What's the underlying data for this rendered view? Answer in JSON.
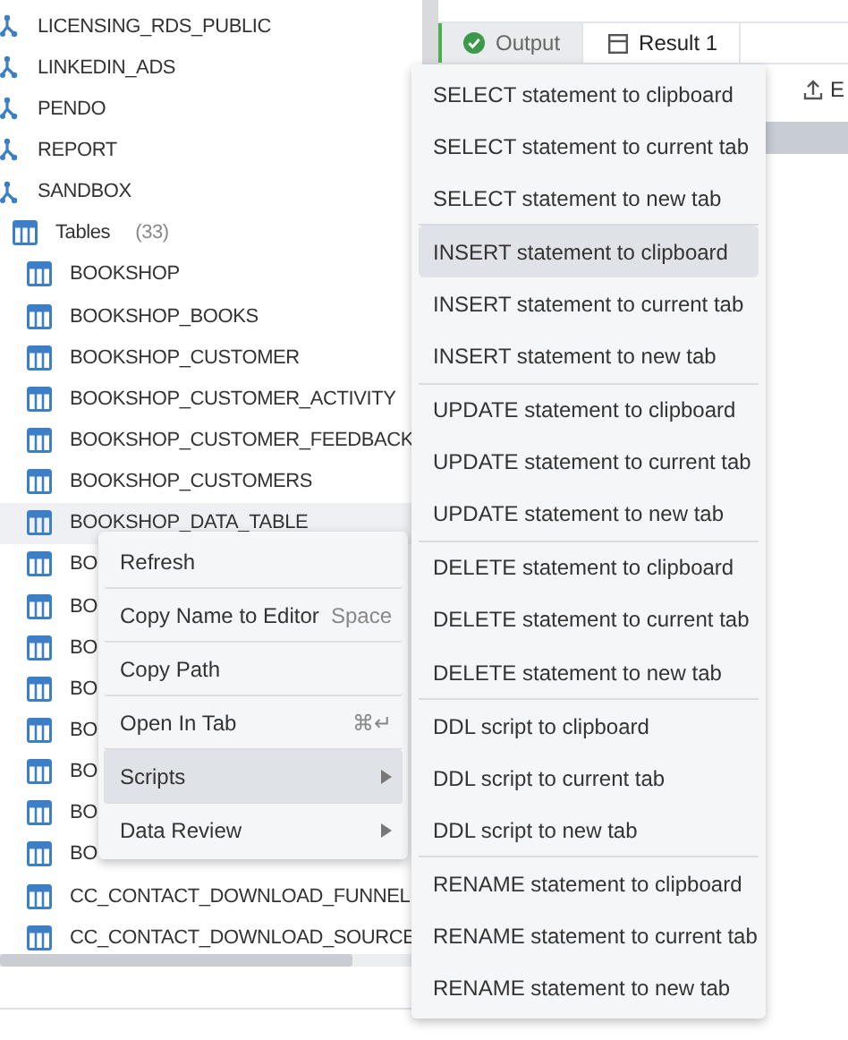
{
  "tree": {
    "schemas": [
      {
        "name": "LICENSING_RDS_PUBLIC"
      },
      {
        "name": "LINKEDIN_ADS"
      },
      {
        "name": "PENDO"
      },
      {
        "name": "REPORT"
      },
      {
        "name": "SANDBOX"
      }
    ],
    "tables_group": {
      "label": "Tables",
      "count": "(33)"
    },
    "tables": [
      {
        "name": "BOOKSHOP",
        "selected": false
      },
      {
        "name": "BOOKSHOP_BOOKS",
        "selected": false
      },
      {
        "name": "BOOKSHOP_CUSTOMER",
        "selected": false
      },
      {
        "name": "BOOKSHOP_CUSTOMER_ACTIVITY",
        "selected": false
      },
      {
        "name": "BOOKSHOP_CUSTOMER_FEEDBACK",
        "selected": false
      },
      {
        "name": "BOOKSHOP_CUSTOMERS",
        "selected": false
      },
      {
        "name": "BOOKSHOP_DATA_TABLE",
        "selected": true
      },
      {
        "name": "BO",
        "selected": false
      },
      {
        "name": "BO",
        "selected": false
      },
      {
        "name": "BO",
        "selected": false
      },
      {
        "name": "BO",
        "selected": false
      },
      {
        "name": "BO",
        "selected": false
      },
      {
        "name": "BO",
        "selected": false
      },
      {
        "name": "BO",
        "selected": false
      },
      {
        "name": "BO",
        "selected": false
      },
      {
        "name": "CC_CONTACT_DOWNLOAD_FUNNEL",
        "selected": false
      },
      {
        "name": "CC_CONTACT_DOWNLOAD_SOURCE",
        "selected": false
      }
    ]
  },
  "tabs": [
    {
      "label": "Output",
      "kind": "output",
      "selected": false
    },
    {
      "label": "Result 1",
      "kind": "result",
      "selected": true
    }
  ],
  "toolbar": {
    "export_label": "E"
  },
  "context_menu": {
    "items": [
      {
        "label": "Refresh",
        "submenu": false,
        "selected": false
      },
      {
        "label": "Copy Name to Editor",
        "shortcut": "Space",
        "submenu": false,
        "selected": false
      },
      {
        "label": "Copy Path",
        "submenu": false,
        "selected": false
      },
      {
        "label": "Open In Tab",
        "shortcut": "⌘↵",
        "submenu": false,
        "selected": false
      },
      {
        "label": "Scripts",
        "submenu": true,
        "selected": true
      },
      {
        "label": "Data Review",
        "submenu": true,
        "selected": false
      }
    ]
  },
  "scripts_menu": {
    "groups": [
      [
        {
          "label": "SELECT statement to clipboard",
          "selected": false
        },
        {
          "label": "SELECT statement to current tab",
          "selected": false
        },
        {
          "label": "SELECT statement to new tab",
          "selected": false
        }
      ],
      [
        {
          "label": "INSERT statement to clipboard",
          "selected": true
        },
        {
          "label": "INSERT statement to current tab",
          "selected": false
        },
        {
          "label": "INSERT statement to new tab",
          "selected": false
        }
      ],
      [
        {
          "label": "UPDATE statement to clipboard",
          "selected": false
        },
        {
          "label": "UPDATE statement to current tab",
          "selected": false
        },
        {
          "label": "UPDATE statement to new tab",
          "selected": false
        }
      ],
      [
        {
          "label": "DELETE statement to clipboard",
          "selected": false
        },
        {
          "label": "DELETE statement to current tab",
          "selected": false
        },
        {
          "label": "DELETE statement to new tab",
          "selected": false
        }
      ],
      [
        {
          "label": "DDL script to clipboard",
          "selected": false
        },
        {
          "label": "DDL script to current tab",
          "selected": false
        },
        {
          "label": "DDL script to new tab",
          "selected": false
        }
      ],
      [
        {
          "label": "RENAME statement to clipboard",
          "selected": false
        },
        {
          "label": "RENAME statement to current tab",
          "selected": false
        },
        {
          "label": "RENAME statement to new tab",
          "selected": false
        }
      ]
    ]
  }
}
